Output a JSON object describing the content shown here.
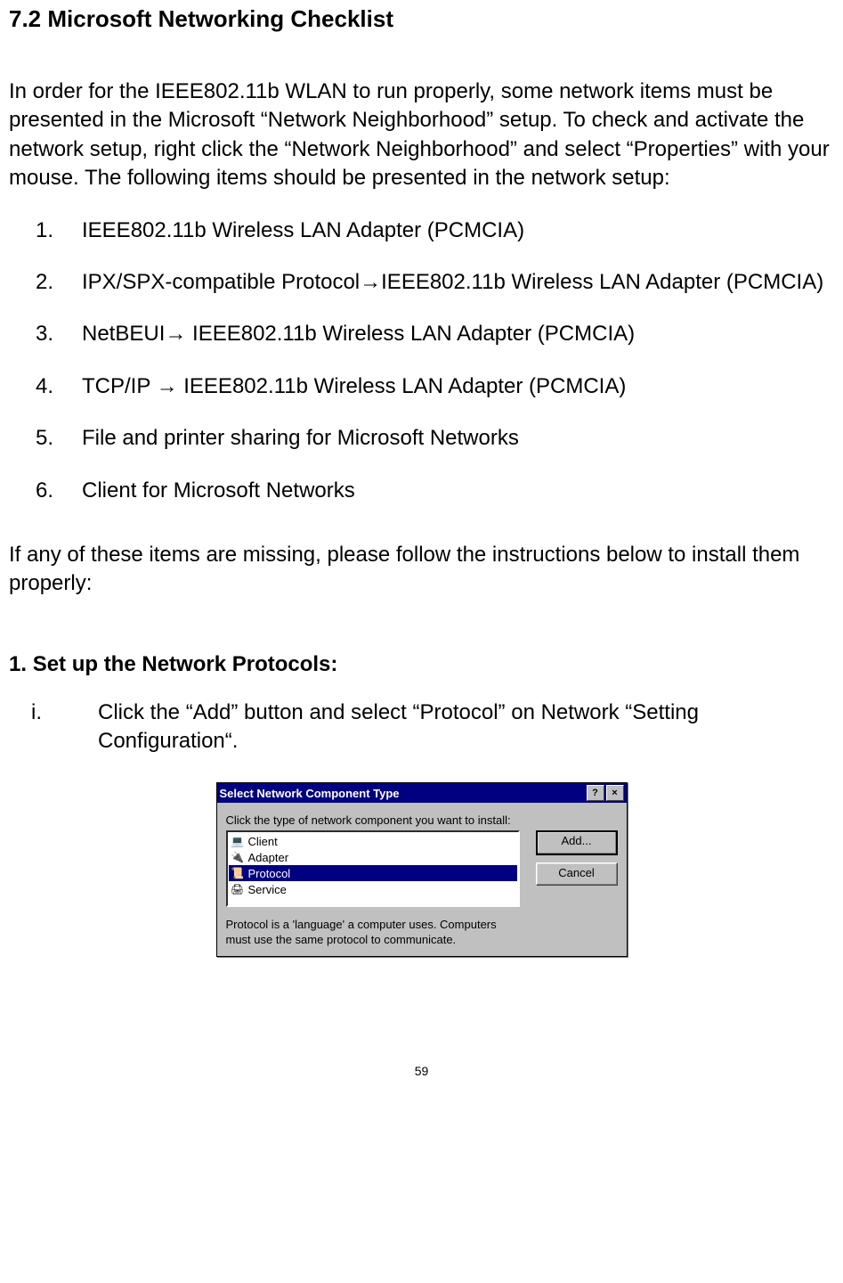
{
  "heading": "7.2 Microsoft Networking Checklist",
  "intro": "In order for the IEEE802.11b WLAN to run properly, some network items must be presented in the Microsoft “Network Neighborhood” setup. To check and activate the network setup, right click the “Network Neighborhood” and select “Properties” with your mouse.  The following items should be presented in the network setup:",
  "checklist": [
    {
      "num": "1.",
      "text": "IEEE802.11b Wireless LAN Adapter (PCMCIA)"
    },
    {
      "num": "2.",
      "text": "IPX/SPX-compatible Protocol→IEEE802.11b Wireless LAN Adapter (PCMCIA)"
    },
    {
      "num": "3.",
      "text": "NetBEUI→ IEEE802.11b Wireless LAN Adapter (PCMCIA)"
    },
    {
      "num": "4.",
      "text": "TCP/IP → IEEE802.11b Wireless LAN Adapter (PCMCIA)"
    },
    {
      "num": "5.",
      "text": "File and printer sharing for Microsoft Networks"
    },
    {
      "num": "6.",
      "text": "Client for Microsoft Networks"
    }
  ],
  "missing_para": "If any of these items are missing, please follow the instructions below to install them properly:",
  "step1_heading_num": "1.",
  "step1_heading_text": "Set up the Network Protocols:",
  "step1_i_num": "i.",
  "step1_i_text": "Click the “Add” button and select  “Protocol” on Network “Setting Configuration“.",
  "dialog": {
    "title": "Select Network Component Type",
    "help_label": "?",
    "close_label": "×",
    "prompt": "Click the type of network component you want to install:",
    "items": [
      {
        "icon": "💻",
        "label": "Client"
      },
      {
        "icon": "🔌",
        "label": "Adapter"
      },
      {
        "icon": "📜",
        "label": "Protocol"
      },
      {
        "icon": "🖨",
        "label": "Service"
      }
    ],
    "add_btn": "Add...",
    "cancel_btn": "Cancel",
    "description": "Protocol is a 'language' a computer uses. Computers must use the same protocol to communicate."
  },
  "page_number": "59"
}
